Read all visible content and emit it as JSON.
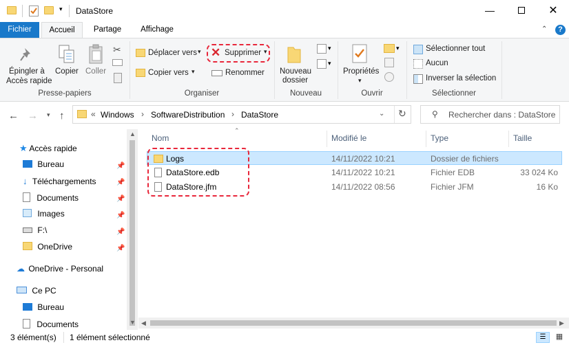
{
  "window": {
    "title": "DataStore"
  },
  "tabs": {
    "file": "Fichier",
    "home": "Accueil",
    "share": "Partage",
    "view": "Affichage"
  },
  "ribbon": {
    "clipboard": {
      "pin_line1": "Épingler à",
      "pin_line2": "Accès rapide",
      "copy": "Copier",
      "paste": "Coller",
      "label": "Presse-papiers"
    },
    "organize": {
      "move_to": "Déplacer vers",
      "copy_to": "Copier vers",
      "delete": "Supprimer",
      "rename": "Renommer",
      "label": "Organiser"
    },
    "new": {
      "folder_line1": "Nouveau",
      "folder_line2": "dossier",
      "label": "Nouveau"
    },
    "open": {
      "properties": "Propriétés",
      "label": "Ouvrir"
    },
    "select": {
      "all": "Sélectionner tout",
      "none": "Aucun",
      "invert": "Inverser la sélection",
      "label": "Sélectionner"
    }
  },
  "address": {
    "chevrons": "«",
    "crumbs": [
      "Windows",
      "SoftwareDistribution",
      "DataStore"
    ],
    "search_placeholder": "Rechercher dans : DataStore"
  },
  "nav": {
    "quick_access": "Accès rapide",
    "items": [
      "Bureau",
      "Téléchargements",
      "Documents",
      "Images",
      "F:\\",
      "OneDrive"
    ],
    "onedrive_personal": "OneDrive - Personal",
    "this_pc": "Ce PC",
    "pc_items": [
      "Bureau",
      "Documents"
    ]
  },
  "columns": {
    "name": "Nom",
    "modified": "Modifié le",
    "type": "Type",
    "size": "Taille"
  },
  "files": [
    {
      "name": "Logs",
      "modified": "14/11/2022 10:21",
      "type": "Dossier de fichiers",
      "size": ""
    },
    {
      "name": "DataStore.edb",
      "modified": "14/11/2022 10:21",
      "type": "Fichier EDB",
      "size": "33 024 Ko"
    },
    {
      "name": "DataStore.jfm",
      "modified": "14/11/2022 08:56",
      "type": "Fichier JFM",
      "size": "16 Ko"
    }
  ],
  "status": {
    "count": "3 élément(s)",
    "selected": "1 élément sélectionné"
  },
  "colors": {
    "accent": "#1979ca",
    "highlight": "#e8263a",
    "selection": "#cce8ff",
    "folder": "#f8d775"
  }
}
